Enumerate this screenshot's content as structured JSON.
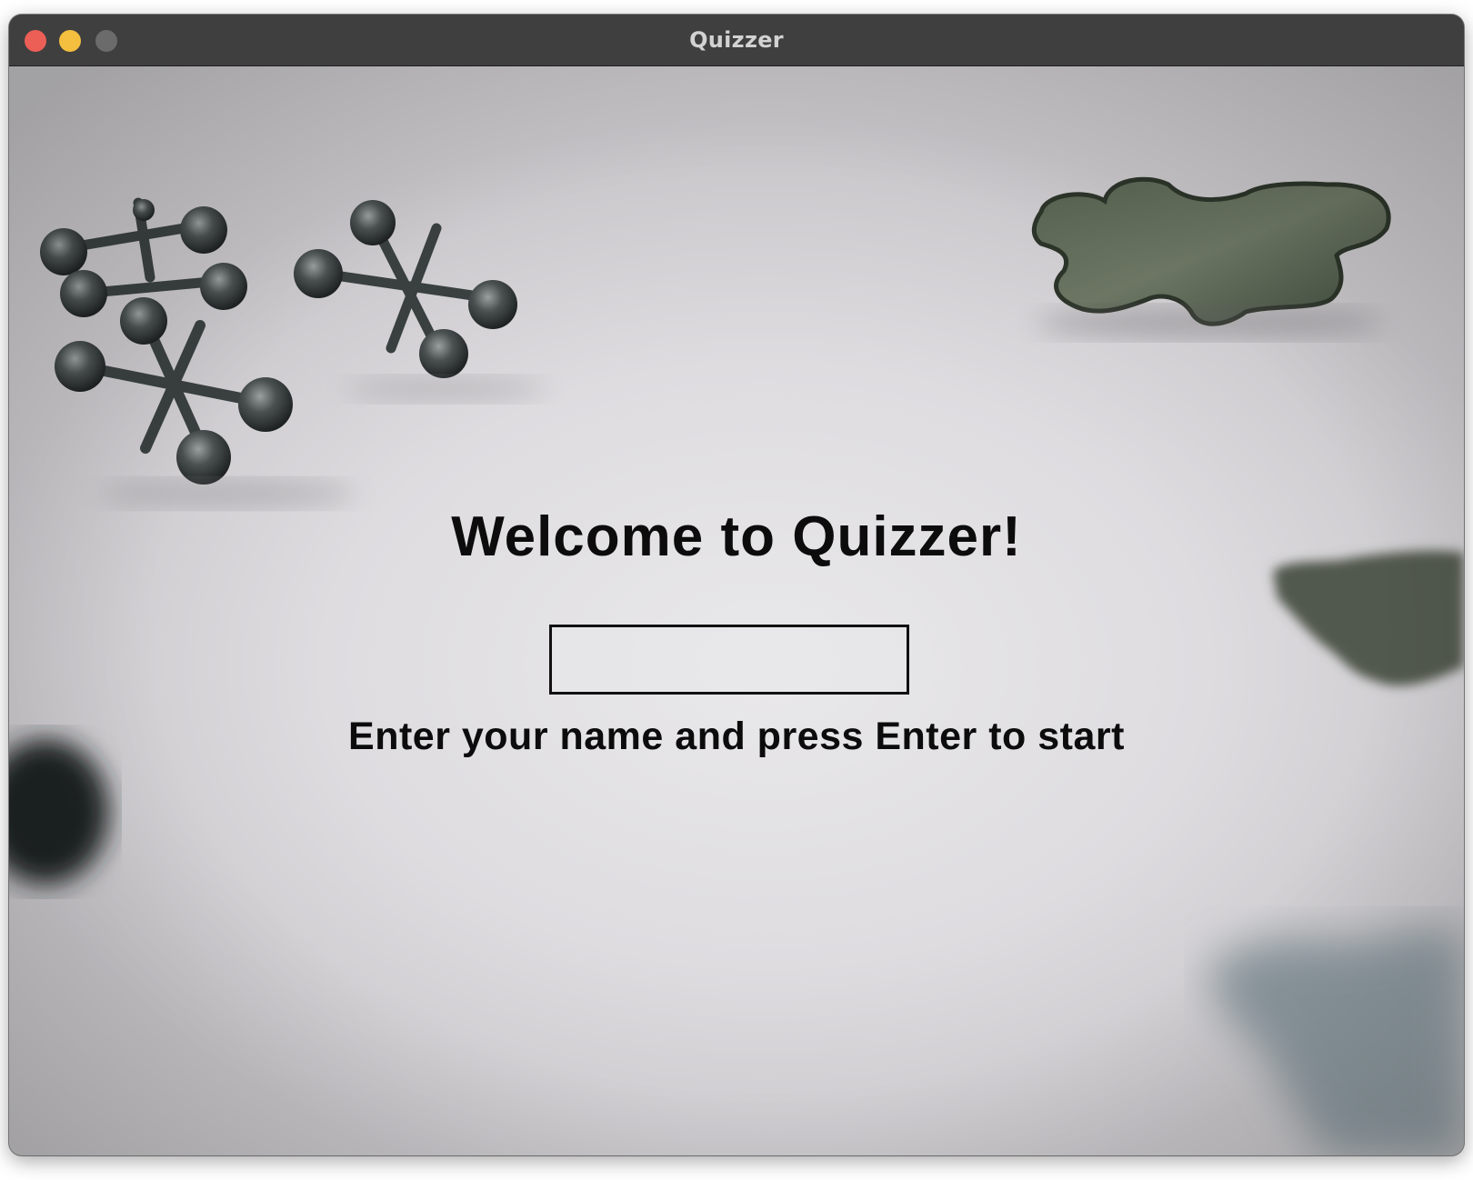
{
  "window": {
    "title": "Quizzer",
    "controls": [
      {
        "name": "close",
        "color": "#ec5f57"
      },
      {
        "name": "minimize",
        "color": "#f4bf3e"
      },
      {
        "name": "zoom",
        "color": "#6b6b6b"
      }
    ]
  },
  "welcome_screen": {
    "heading": "Welcome to Quizzer!",
    "name_input": {
      "value": "",
      "placeholder": ""
    },
    "instruction": "Enter your name and press Enter to start"
  },
  "background": {
    "description_icons": [
      "jacks-toy-icon",
      "puzzle-piece-icon"
    ]
  }
}
